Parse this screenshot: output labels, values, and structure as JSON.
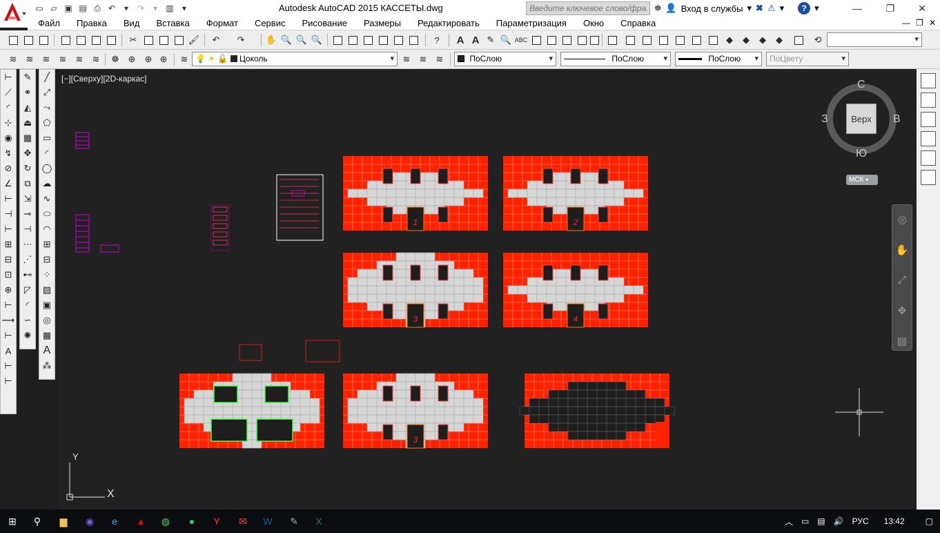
{
  "window": {
    "title": "Autodesk AutoCAD 2015    КАССЕТЫ.dwg",
    "search_placeholder": "Введите ключевое слово/фразу",
    "signin": "Вход в службы"
  },
  "menu": [
    "Файл",
    "Правка",
    "Вид",
    "Вставка",
    "Формат",
    "Сервис",
    "Рисование",
    "Размеры",
    "Редактировать",
    "Параметризация",
    "Окно",
    "Справка"
  ],
  "layers_toolbar": {
    "layer": "Цоколь",
    "color": "ПоСлою",
    "linetype": "ПоСлою",
    "lineweight": "ПоСлою",
    "plotstyle": "ПоЦвету"
  },
  "viewport": {
    "label": "[−][Сверху][2D-каркас]"
  },
  "viewcube": {
    "north": "С",
    "south": "Ю",
    "east": "В",
    "west": "З",
    "face": "Верх",
    "ucs": "МСК"
  },
  "ucs_axes": {
    "x": "X",
    "y": "Y"
  },
  "panels": [
    {
      "number": "1",
      "variant": "windows-top-bottom",
      "size": "small-cross"
    },
    {
      "number": "2",
      "variant": "windows-top-bottom",
      "size": "small-cross"
    },
    {
      "number": "3",
      "variant": "windows-middle-bottom",
      "size": "wide-cross"
    },
    {
      "number": "4",
      "variant": "windows-top-bottom",
      "size": "small-cross"
    },
    {
      "number": "",
      "variant": "green-windows",
      "size": "wide-cross"
    },
    {
      "number": "3",
      "variant": "windows-middle-bottom",
      "size": "wide-cross"
    },
    {
      "number": "",
      "variant": "dark-ellipse",
      "size": "ellipse"
    }
  ],
  "colors": {
    "panel_red": "#ff2200",
    "panel_grid": "#ff9a7a",
    "brick": "#d6d6d6",
    "window": "#1e1e1e",
    "green_outline": "#44ff44",
    "magenta": "#cc00cc",
    "canvas": "#212121"
  },
  "taskbar": {
    "language": "РУС",
    "time": "13:42"
  }
}
